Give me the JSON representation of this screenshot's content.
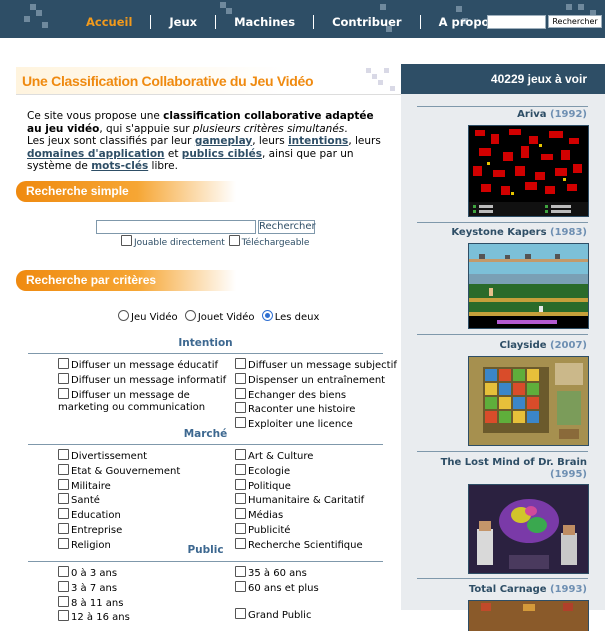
{
  "nav": {
    "items": [
      "Accueil",
      "Jeux",
      "Machines",
      "Contribuer",
      "A propos"
    ],
    "active": "Accueil",
    "search_button": "Rechercher"
  },
  "main": {
    "title": "Une Classification Collaborative du Jeu Vidéo",
    "intro": {
      "p1_a": "Ce site vous propose une ",
      "p1_b": "classification collaborative adaptée au jeu vidéo",
      "p1_c": ", qui s'appuie sur ",
      "p1_d": "plusieurs critères simultanés",
      "p1_e": ".",
      "p2_a": "Les jeux sont classifiés par leur ",
      "link_gameplay": "gameplay",
      "p2_b": ", leurs ",
      "link_intentions": "intentions",
      "p2_c": ", leurs ",
      "link_domaines": "domaines d'application",
      "p2_d": " et ",
      "link_publics": "publics ciblés",
      "p2_e": ", ainsi que par un système de ",
      "link_motscles": "mots-clés",
      "p2_f": " libre."
    },
    "simple_search": {
      "title": "Recherche simple",
      "button": "Rechercher",
      "opt1": "Jouable directement",
      "opt2": "Téléchargeable"
    },
    "criteria_search": {
      "title": "Recherche par critères",
      "radios": [
        "Jeu Vidéo",
        "Jouet Vidéo",
        "Les deux"
      ],
      "radio_selected": 2,
      "groups": {
        "intention": {
          "title": "Intention",
          "left": [
            "Diffuser un message éducatif",
            "Diffuser un message informatif",
            "Diffuser un message de marketing ou communication"
          ],
          "right": [
            "Diffuser un message subjectif",
            "Dispenser un entraînement",
            "Echanger des biens",
            "Raconter une histoire",
            "Exploiter une licence"
          ]
        },
        "marche": {
          "title": "Marché",
          "left": [
            "Divertissement",
            "Etat & Gouvernement",
            "Militaire",
            "Santé",
            "Education",
            "Entreprise",
            "Religion"
          ],
          "right": [
            "Art & Culture",
            "Ecologie",
            "Politique",
            "Humanitaire & Caritatif",
            "Médias",
            "Publicité",
            "Recherche Scientifique"
          ]
        },
        "public": {
          "title": "Public",
          "left": [
            "0 à 3 ans",
            "3 à 7 ans",
            "8 à 11 ans",
            "12 à 16 ans"
          ],
          "right": [
            "35 à 60 ans",
            "60 ans et plus",
            "",
            "Grand Public"
          ]
        }
      }
    }
  },
  "sidebar": {
    "header": "40229 jeux à voir",
    "games": [
      {
        "name": "Ariva",
        "year": "(1992)"
      },
      {
        "name": "Keystone Kapers",
        "year": "(1983)"
      },
      {
        "name": "Clayside",
        "year": "(2007)"
      },
      {
        "name": "The Lost Mind of Dr. Brain",
        "year": "(1995)"
      },
      {
        "name": "Total Carnage",
        "year": "(1993)"
      }
    ]
  },
  "colors": {
    "navy": "#2e4e66",
    "orange": "#ef8a10",
    "link": "#2e4e66"
  }
}
